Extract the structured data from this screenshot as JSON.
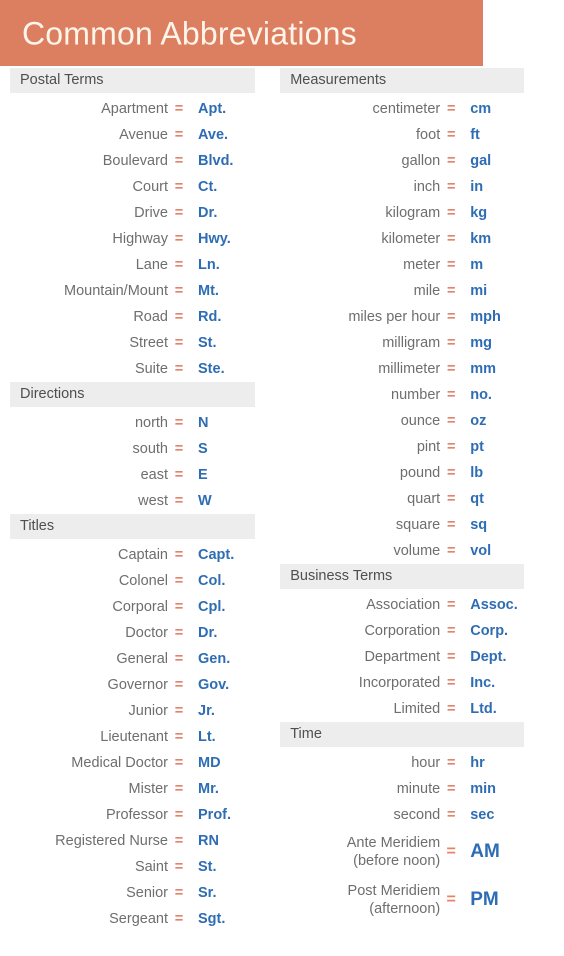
{
  "header": {
    "title": "Common Abbreviations",
    "banner_color": "#DC7F61",
    "title_color": "#FDF4EA"
  },
  "theme": {
    "term_color": "#6E6E6E",
    "equals_color": "#E4826A",
    "abbr_color": "#2E6DB4",
    "section_bar_color": "#EDEDED",
    "section_label_color": "#4F4F4F",
    "equals_symbol": "="
  },
  "columns": {
    "left": [
      {
        "section": "Postal Terms",
        "entries": [
          {
            "term": "Apartment",
            "abbr": "Apt."
          },
          {
            "term": "Avenue",
            "abbr": "Ave."
          },
          {
            "term": "Boulevard",
            "abbr": "Blvd."
          },
          {
            "term": "Court",
            "abbr": "Ct."
          },
          {
            "term": "Drive",
            "abbr": "Dr."
          },
          {
            "term": "Highway",
            "abbr": "Hwy."
          },
          {
            "term": "Lane",
            "abbr": "Ln."
          },
          {
            "term": "Mountain/Mount",
            "abbr": "Mt."
          },
          {
            "term": "Road",
            "abbr": "Rd."
          },
          {
            "term": "Street",
            "abbr": "St."
          },
          {
            "term": "Suite",
            "abbr": "Ste."
          }
        ]
      },
      {
        "section": "Directions",
        "entries": [
          {
            "term": "north",
            "abbr": "N"
          },
          {
            "term": "south",
            "abbr": "S"
          },
          {
            "term": "east",
            "abbr": "E"
          },
          {
            "term": "west",
            "abbr": "W"
          }
        ]
      },
      {
        "section": "Titles",
        "entries": [
          {
            "term": "Captain",
            "abbr": "Capt."
          },
          {
            "term": "Colonel",
            "abbr": "Col."
          },
          {
            "term": "Corporal",
            "abbr": "Cpl."
          },
          {
            "term": "Doctor",
            "abbr": "Dr."
          },
          {
            "term": "General",
            "abbr": "Gen."
          },
          {
            "term": "Governor",
            "abbr": "Gov."
          },
          {
            "term": "Junior",
            "abbr": "Jr."
          },
          {
            "term": "Lieutenant",
            "abbr": "Lt."
          },
          {
            "term": "Medical Doctor",
            "abbr": "MD"
          },
          {
            "term": "Mister",
            "abbr": "Mr."
          },
          {
            "term": "Professor",
            "abbr": "Prof."
          },
          {
            "term": "Registered Nurse",
            "abbr": "RN"
          },
          {
            "term": "Saint",
            "abbr": "St."
          },
          {
            "term": "Senior",
            "abbr": "Sr."
          },
          {
            "term": "Sergeant",
            "abbr": "Sgt."
          }
        ]
      }
    ],
    "right": [
      {
        "section": "Measurements",
        "entries": [
          {
            "term": "centimeter",
            "abbr": "cm"
          },
          {
            "term": "foot",
            "abbr": "ft"
          },
          {
            "term": "gallon",
            "abbr": "gal"
          },
          {
            "term": "inch",
            "abbr": "in"
          },
          {
            "term": "kilogram",
            "abbr": "kg"
          },
          {
            "term": "kilometer",
            "abbr": "km"
          },
          {
            "term": "meter",
            "abbr": "m"
          },
          {
            "term": "mile",
            "abbr": "mi"
          },
          {
            "term": "miles per hour",
            "abbr": "mph"
          },
          {
            "term": "milligram",
            "abbr": "mg"
          },
          {
            "term": "millimeter",
            "abbr": "mm"
          },
          {
            "term": "number",
            "abbr": "no."
          },
          {
            "term": "ounce",
            "abbr": "oz"
          },
          {
            "term": "pint",
            "abbr": "pt"
          },
          {
            "term": "pound",
            "abbr": "lb"
          },
          {
            "term": "quart",
            "abbr": "qt"
          },
          {
            "term": "square",
            "abbr": "sq"
          },
          {
            "term": "volume",
            "abbr": "vol"
          }
        ]
      },
      {
        "section": "Business Terms",
        "entries": [
          {
            "term": "Association",
            "abbr": "Assoc."
          },
          {
            "term": "Corporation",
            "abbr": "Corp."
          },
          {
            "term": "Department",
            "abbr": "Dept."
          },
          {
            "term": "Incorporated",
            "abbr": "Inc."
          },
          {
            "term": "Limited",
            "abbr": "Ltd."
          }
        ]
      },
      {
        "section": "Time",
        "entries": [
          {
            "term": "hour",
            "abbr": "hr"
          },
          {
            "term": "minute",
            "abbr": "min"
          },
          {
            "term": "second",
            "abbr": "sec"
          },
          {
            "term": "Ante Meridiem\n(before noon)",
            "abbr": "AM",
            "tall": true
          },
          {
            "term": "Post Meridiem\n(afternoon)",
            "abbr": "PM",
            "tall": true
          }
        ]
      }
    ]
  }
}
